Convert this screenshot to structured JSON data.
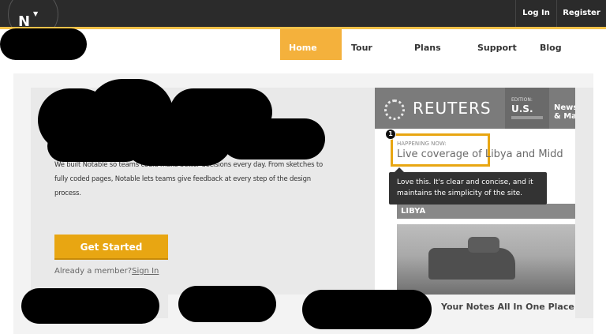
{
  "topbar": {
    "logo_letter": "N",
    "logo_caret": "▼",
    "login_label": "Log In",
    "register_label": "Register"
  },
  "nav": {
    "items": [
      "Home",
      "Tour",
      "Plans",
      "Support",
      "Blog"
    ],
    "active": "Home"
  },
  "hero": {
    "description": "We built Notable so teams could make better decisions every day. From sketches to fully coded pages, Notable lets teams give feedback at every step of the design process.",
    "cta_label": "Get Started",
    "member_text": "Already a member?",
    "signin_label": "Sign In"
  },
  "screenshot": {
    "brand": "REUTERS",
    "edition_label": "EDITION:",
    "edition_value": "U.S.",
    "news_label": "News\n& Ma",
    "happening_label": "HAPPENING NOW:",
    "happening_text": "Live coverage of Libya and Midd",
    "section_label": "LIBYA",
    "marker_number": "1"
  },
  "tooltip": {
    "text": "Love this. It's clear and concise, and it maintains the simplicity of the site."
  },
  "footer_strip": {
    "notes_label": "Your Notes All In One Place"
  },
  "colors": {
    "accent": "#f4b13c",
    "cta": "#e8a612",
    "topbar": "#2b2b2b"
  }
}
